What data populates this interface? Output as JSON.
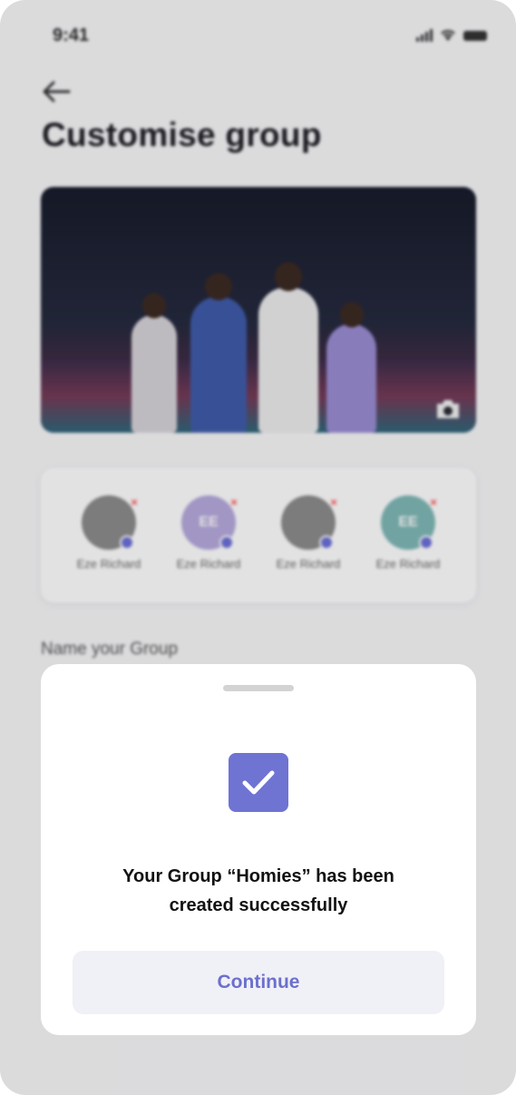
{
  "status_bar": {
    "time": "9:41"
  },
  "header": {
    "title": "Customise group"
  },
  "members": [
    {
      "name": "Eze Richard",
      "initials": "",
      "avatar_color": "#8b8b8b"
    },
    {
      "name": "Eze Richard",
      "initials": "EE",
      "avatar_color": "#b6a9dc"
    },
    {
      "name": "Eze Richard",
      "initials": "",
      "avatar_color": "#8b8b8b"
    },
    {
      "name": "Eze Richard",
      "initials": "EE",
      "avatar_color": "#7fb8b5"
    }
  ],
  "form": {
    "name_label": "Name your Group"
  },
  "modal": {
    "message_line1": "Your Group “Homies” has been",
    "message_line2": "created successfully",
    "continue_label": "Continue"
  },
  "colors": {
    "accent": "#6f73d2",
    "button_bg": "#f0f0f7"
  },
  "icons": [
    "back-arrow-icon",
    "camera-icon",
    "check-icon",
    "close-icon",
    "signal-icon",
    "wifi-icon",
    "battery-icon"
  ]
}
